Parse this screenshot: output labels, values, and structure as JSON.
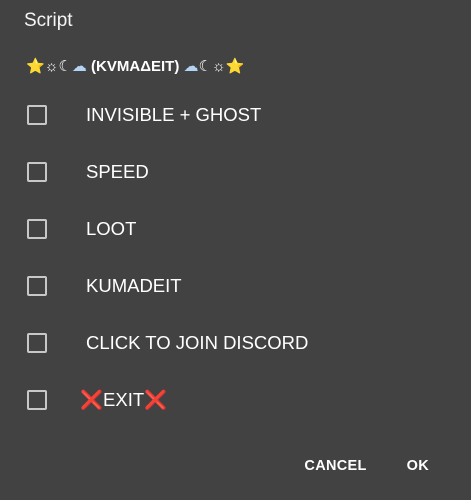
{
  "dialog": {
    "title": "Script",
    "subtitle": {
      "prefix": "⭐☼☾",
      "cloud": "☁",
      "text": " (ΚVΜΑΔΕΙΤ) ",
      "suffix": "☾☼⭐"
    },
    "options": [
      {
        "label": "INVISIBLE + GHOST",
        "checked": false
      },
      {
        "label": "SPEED",
        "checked": false
      },
      {
        "label": "LOOT",
        "checked": false
      },
      {
        "label": "KUMADEIT",
        "checked": false
      },
      {
        "label": "CLICK TO JOIN DISCORD",
        "checked": false
      },
      {
        "label": "EXIT",
        "checked": false,
        "decoration": "❌"
      }
    ],
    "buttons": {
      "cancel": "CANCEL",
      "ok": "OK"
    },
    "colors": {
      "background": "#424242",
      "text": "#ffffff",
      "checkbox_border": "#c8c8c8",
      "exit_mark": "#e53935"
    }
  }
}
